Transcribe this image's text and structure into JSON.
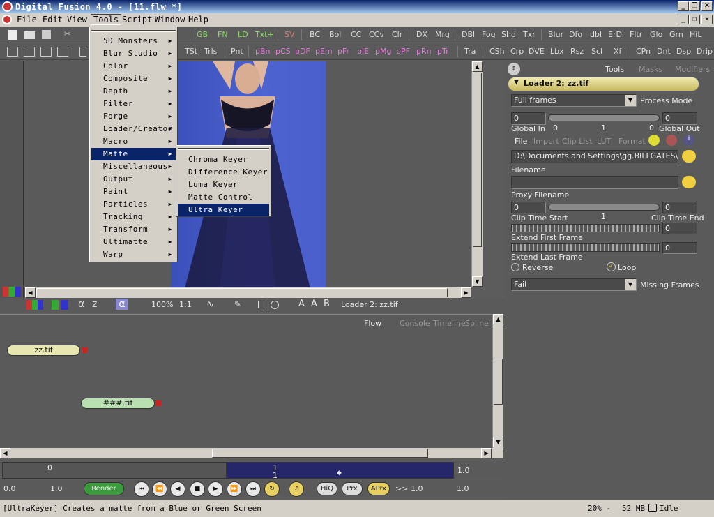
{
  "window": {
    "title": "Digital Fusion 4.0 - [11.flw *]"
  },
  "menubar": [
    "File",
    "Edit",
    "View",
    "Tools",
    "Script",
    "Window",
    "Help"
  ],
  "toolbar1": [
    "GB",
    "FN",
    "LD",
    "Txt+",
    "SV",
    "BC",
    "Bol",
    "CC",
    "CCv",
    "Clr",
    "DX",
    "Mrg",
    "DBl",
    "Fog",
    "Shd",
    "Txr",
    "Blur",
    "Dfo",
    "dbl",
    "ErDl",
    "Fltr",
    "Glo",
    "Grn",
    "HiL"
  ],
  "toolbar2": [
    "TSt",
    "Trls",
    "Pnt",
    "pBn",
    "pCS",
    "pDF",
    "pEm",
    "pFr",
    "pIE",
    "pMg",
    "pPF",
    "pRn",
    "pTr",
    "Tra",
    "CSh",
    "Crp",
    "DVE",
    "Lbx",
    "Rsz",
    "Scl",
    "Xf",
    "CPn",
    "Dnt",
    "Dsp",
    "Drip"
  ],
  "tools_menu": {
    "items": [
      "5D Monsters",
      "Blur Studio",
      "Color",
      "Composite",
      "Depth",
      "Filter",
      "Forge",
      "Loader/Creator",
      "Macro",
      "Matte",
      "Miscellaneous",
      "Output",
      "Paint",
      "Particles",
      "Tracking",
      "Transform",
      "Ultimatte",
      "Warp"
    ],
    "selected": "Matte"
  },
  "matte_submenu": {
    "items": [
      "Chroma Keyer",
      "Difference Keyer",
      "Luma Keyer",
      "Matte Control",
      "Ultra Keyer"
    ],
    "selected": "Ultra Keyer"
  },
  "viewer_bar": {
    "zoom": "100%",
    "ratio": "1:1",
    "label": "Loader 2: zz.tif",
    "letters": [
      "α",
      "z",
      "α",
      "A",
      "A",
      "B"
    ]
  },
  "right_panel": {
    "tabs": [
      "Tools",
      "Masks",
      "Modifiers"
    ],
    "header": "Loader 2: zz.tif",
    "process_mode_value": "Full frames",
    "process_mode_label": "Process Mode",
    "global_in_value": "0",
    "global_out_value": "0",
    "global_in_label": "Global In",
    "global_out_label": "Global Out",
    "global_scale": [
      "0",
      "1",
      "0"
    ],
    "subtabs": [
      "File",
      "Import",
      "Clip List",
      "LUT",
      "Format"
    ],
    "path": "D:\\Documents and Settings\\gg.BILLGATES\\桌面\\",
    "filename_label": "Filename",
    "proxy_label": "Proxy Filename",
    "clip_start_value": "0",
    "clip_end_value": "0",
    "clip_mid": "1",
    "clip_start_label": "Clip Time Start",
    "clip_end_label": "Clip Time End",
    "extend_first_value": "0",
    "extend_first_label": "Extend First Frame",
    "extend_last_value": "0",
    "extend_last_label": "Extend Last Frame",
    "reverse_label": "Reverse",
    "loop_label": "Loop",
    "missing_value": "Fail",
    "missing_label": "Missing Frames"
  },
  "flow": {
    "tabs": [
      "Flow",
      "Console",
      "Timeline",
      "Spline"
    ],
    "nodes": [
      {
        "label": "zz.tif"
      },
      {
        "label": "###.tif"
      }
    ]
  },
  "timeline": {
    "start": "0",
    "marker": "1",
    "marker2": "1",
    "right": "1.0"
  },
  "controls": {
    "start": "0.0",
    "end": "1.0",
    "render": "Render",
    "hiq": "HiQ",
    "prx": "Prx",
    "aprx": "APrx",
    "chev": ">>",
    "val1": "1.0",
    "val2": "1.0"
  },
  "status": {
    "text": "[UltraKeyer] Creates a matte from a Blue or Green Screen",
    "zoom": "20% -",
    "mem": "52 MB",
    "state": "Idle"
  }
}
